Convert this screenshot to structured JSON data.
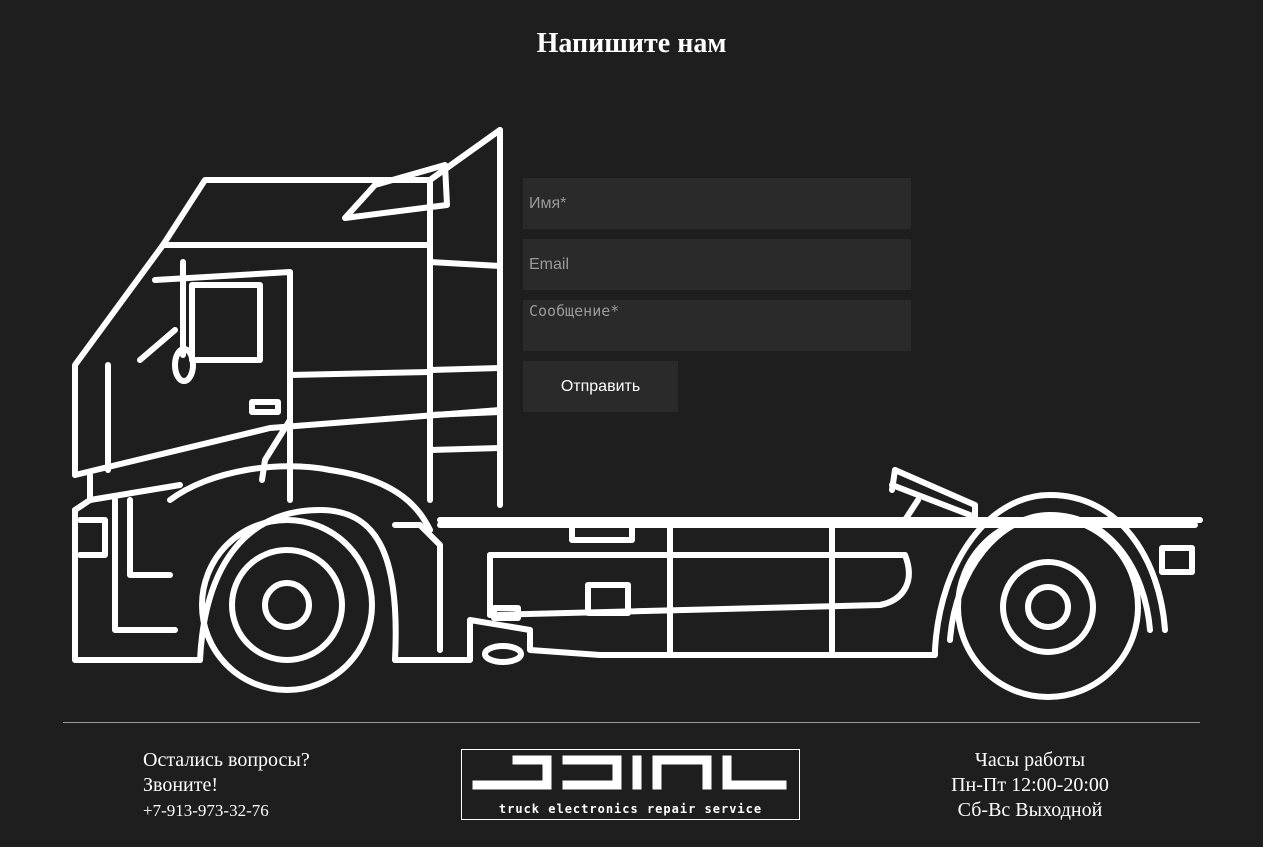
{
  "header": {
    "title": "Напишите нам"
  },
  "form": {
    "name_placeholder": "Имя*",
    "email_placeholder": "Email",
    "message_placeholder": "Сообщение*",
    "submit_label": "Отправить"
  },
  "footer": {
    "contact": {
      "line1": "Остались вопросы?",
      "line2": "Звоните!",
      "phone": "+7-913-973-32-76"
    },
    "logo": {
      "mark": "JDIAL",
      "tagline": "truck electronics repair service"
    },
    "hours": {
      "title": "Часы работы",
      "weekdays": "Пн-Пт 12:00-20:00",
      "weekend": "Сб-Вс Выходной"
    }
  },
  "colors": {
    "background": "#1e1e1e",
    "field_background": "#2a2a2a",
    "line_art": "#ffffff"
  }
}
